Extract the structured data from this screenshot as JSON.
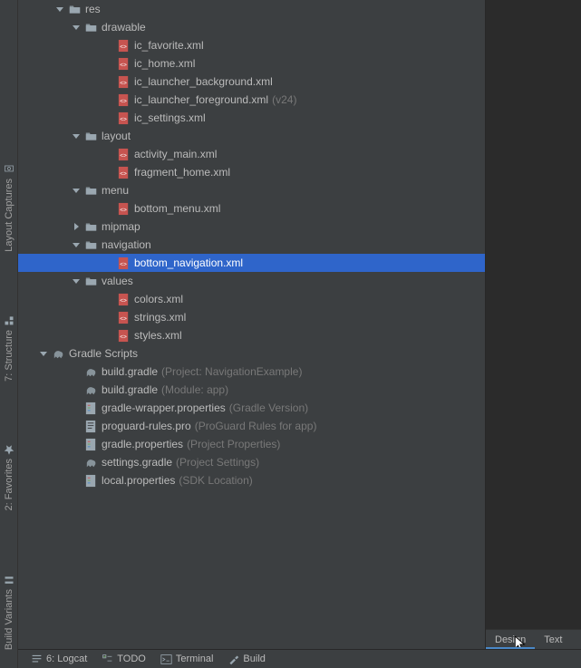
{
  "sidebar_tabs": [
    {
      "id": "layout-captures",
      "label": "Layout Captures"
    },
    {
      "id": "structure",
      "label": "7: Structure"
    },
    {
      "id": "favorites",
      "label": "2: Favorites"
    },
    {
      "id": "build-variants",
      "label": "Build Variants"
    }
  ],
  "tree": [
    {
      "depth": 2,
      "arrow": "down",
      "icon": "folder",
      "label": "res"
    },
    {
      "depth": 3,
      "arrow": "down",
      "icon": "folder",
      "label": "drawable"
    },
    {
      "depth": 5,
      "arrow": "",
      "icon": "xml",
      "label": "ic_favorite.xml"
    },
    {
      "depth": 5,
      "arrow": "",
      "icon": "xml",
      "label": "ic_home.xml"
    },
    {
      "depth": 5,
      "arrow": "",
      "icon": "xml",
      "label": "ic_launcher_background.xml"
    },
    {
      "depth": 5,
      "arrow": "",
      "icon": "xml",
      "label": "ic_launcher_foreground.xml",
      "hint": "(v24)"
    },
    {
      "depth": 5,
      "arrow": "",
      "icon": "xml",
      "label": "ic_settings.xml"
    },
    {
      "depth": 3,
      "arrow": "down",
      "icon": "folder",
      "label": "layout"
    },
    {
      "depth": 5,
      "arrow": "",
      "icon": "xml",
      "label": "activity_main.xml"
    },
    {
      "depth": 5,
      "arrow": "",
      "icon": "xml",
      "label": "fragment_home.xml"
    },
    {
      "depth": 3,
      "arrow": "down",
      "icon": "folder",
      "label": "menu"
    },
    {
      "depth": 5,
      "arrow": "",
      "icon": "xml",
      "label": "bottom_menu.xml"
    },
    {
      "depth": 3,
      "arrow": "right",
      "icon": "folder",
      "label": "mipmap"
    },
    {
      "depth": 3,
      "arrow": "down",
      "icon": "folder",
      "label": "navigation"
    },
    {
      "depth": 5,
      "arrow": "",
      "icon": "xml",
      "label": "bottom_navigation.xml",
      "selected": true
    },
    {
      "depth": 3,
      "arrow": "down",
      "icon": "folder",
      "label": "values"
    },
    {
      "depth": 5,
      "arrow": "",
      "icon": "xml",
      "label": "colors.xml"
    },
    {
      "depth": 5,
      "arrow": "",
      "icon": "xml",
      "label": "strings.xml"
    },
    {
      "depth": 5,
      "arrow": "",
      "icon": "xml",
      "label": "styles.xml"
    },
    {
      "depth": 1,
      "arrow": "down",
      "icon": "gradle-scripts",
      "label": "Gradle Scripts"
    },
    {
      "depth": 3,
      "arrow": "",
      "icon": "gradle",
      "label": "build.gradle",
      "hint": "(Project: NavigationExample)"
    },
    {
      "depth": 3,
      "arrow": "",
      "icon": "gradle",
      "label": "build.gradle",
      "hint": "(Module: app)"
    },
    {
      "depth": 3,
      "arrow": "",
      "icon": "props",
      "label": "gradle-wrapper.properties",
      "hint": "(Gradle Version)"
    },
    {
      "depth": 3,
      "arrow": "",
      "icon": "text",
      "label": "proguard-rules.pro",
      "hint": "(ProGuard Rules for app)"
    },
    {
      "depth": 3,
      "arrow": "",
      "icon": "props",
      "label": "gradle.properties",
      "hint": "(Project Properties)"
    },
    {
      "depth": 3,
      "arrow": "",
      "icon": "gradle",
      "label": "settings.gradle",
      "hint": "(Project Settings)"
    },
    {
      "depth": 3,
      "arrow": "",
      "icon": "props",
      "label": "local.properties",
      "hint": "(SDK Location)"
    }
  ],
  "editor_tabs": [
    {
      "label": "Design",
      "active": true
    },
    {
      "label": "Text",
      "active": false
    }
  ],
  "bottom_bar": [
    {
      "icon": "logcat",
      "label": "6: Logcat"
    },
    {
      "icon": "todo",
      "label": "TODO"
    },
    {
      "icon": "terminal",
      "label": "Terminal"
    },
    {
      "icon": "build",
      "label": "Build"
    }
  ]
}
